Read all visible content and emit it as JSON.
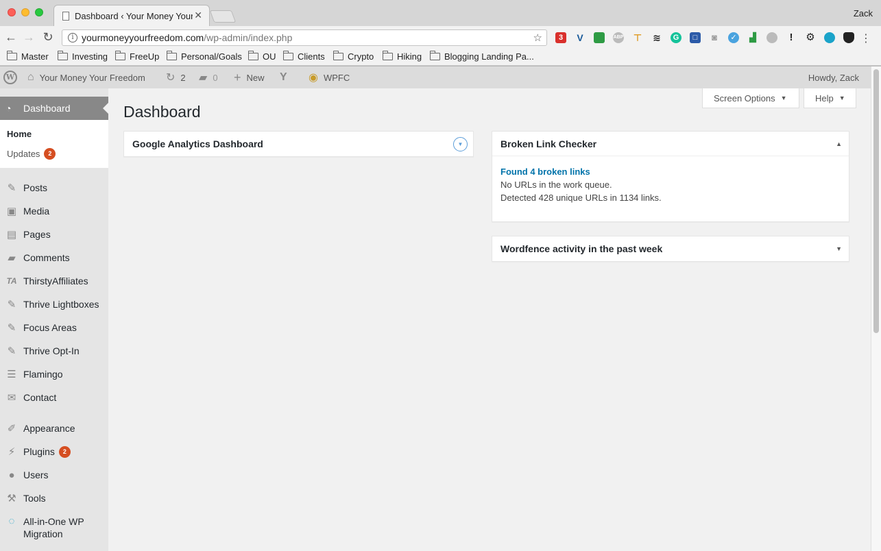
{
  "browser": {
    "tab_title": "Dashboard ‹ Your Money Your Freedom",
    "tab_close": "✕",
    "profile_name": "Zack",
    "url_host": "yourmoneyyourfreedom.com",
    "url_path": "/wp-admin/index.php",
    "bookmarks": [
      "Master",
      "Investing",
      "FreeUp",
      "Personal/Goals",
      "OU",
      "Clients",
      "Crypto",
      "Hiking",
      "Blogging Landing Pa..."
    ]
  },
  "adminbar": {
    "site_name": "Your Money Your Freedom",
    "updates_count": "2",
    "comments_count": "0",
    "new_label": "New",
    "wpfc_label": "WPFC",
    "howdy": "Howdy, Zack"
  },
  "sidebar": {
    "current": "Dashboard",
    "submenu": {
      "home": "Home",
      "updates": "Updates",
      "updates_badge": "2"
    },
    "items": [
      {
        "label": "Posts",
        "icon": "pin-icon"
      },
      {
        "label": "Media",
        "icon": "media-icon"
      },
      {
        "label": "Pages",
        "icon": "pages-icon"
      },
      {
        "label": "Comments",
        "icon": "comments-icon"
      },
      {
        "label": "ThirstyAffiliates",
        "icon": "ta-icon"
      },
      {
        "label": "Thrive Lightboxes",
        "icon": "pin-icon"
      },
      {
        "label": "Focus Areas",
        "icon": "pin-icon"
      },
      {
        "label": "Thrive Opt-In",
        "icon": "pin-icon"
      },
      {
        "label": "Flamingo",
        "icon": "list-icon"
      },
      {
        "label": "Contact",
        "icon": "mail-icon"
      },
      {
        "label": "Appearance",
        "icon": "brush-icon"
      },
      {
        "label": "Plugins",
        "icon": "plugin-icon",
        "badge": "2"
      },
      {
        "label": "Users",
        "icon": "user-icon"
      },
      {
        "label": "Tools",
        "icon": "wrench-icon"
      },
      {
        "label": "All-in-One WP",
        "label2": "Migration",
        "icon": "migration-icon"
      }
    ]
  },
  "main": {
    "title": "Dashboard",
    "screen_options": "Screen Options",
    "help": "Help",
    "widgets": {
      "ga_title": "Google Analytics Dashboard",
      "blc_title": "Broken Link Checker",
      "blc_link": "Found 4 broken links",
      "blc_line1": "No URLs in the work queue.",
      "blc_line2": "Detected 428 unique URLs in 1134 links.",
      "wordfence_title": "Wordfence activity in the past week"
    }
  },
  "colors": {
    "admin_menu_active": "#888888",
    "badge": "#d54e21",
    "link": "#0073aa"
  }
}
